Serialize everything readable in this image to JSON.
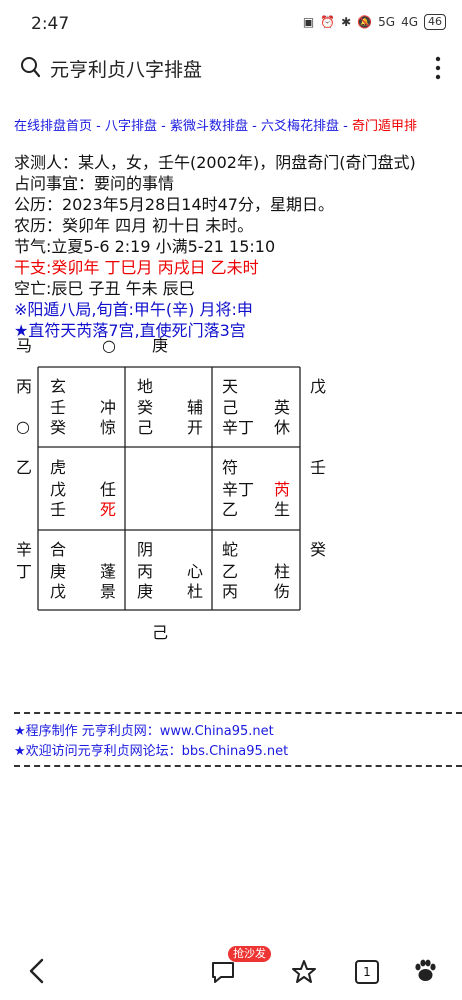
{
  "status": {
    "time": "2:47",
    "signal_a": "5G",
    "signal_b": "4G",
    "battery": "46"
  },
  "search": {
    "title": "元亨利贞八字排盘"
  },
  "nav": {
    "items": [
      "在线排盘首页",
      "八字排盘",
      "紫微斗数排盘",
      "六爻梅花排盘"
    ],
    "current": "奇门遁甲排",
    "sep": " - "
  },
  "info": {
    "line1": "求测人：某人，女，壬午(2002年)，阴盘奇门(奇门盘式)",
    "line2": "占问事宜：要问的事情",
    "line3": "公历：2023年5月28日14时47分，星期日。",
    "line4": "农历：癸卯年 四月 初十日 未时。",
    "line5": "节气:立夏5-6 2:19  小满5-21 15:10",
    "line6": "干支:癸卯年 丁巳月 丙戌日 乙未时",
    "line7": "空亡:辰巳    子丑    午未    辰巳",
    "line8": "※阳遁八局,旬首:甲午(辛) 月将:申",
    "line9": "★直符天芮落7宫,直使死门落3宫"
  },
  "chart": {
    "top": {
      "a": "马",
      "b": "○",
      "c": "庚"
    },
    "left": [
      "丙",
      "○",
      "乙",
      "辛",
      "丁"
    ],
    "right": [
      "戊",
      "壬",
      "癸"
    ],
    "bottom": "己",
    "cells": {
      "r1c1": {
        "god": "玄",
        "l2a": "壬",
        "l2b": "冲",
        "l3a": "癸",
        "l3b": "惊"
      },
      "r1c2": {
        "god": "地",
        "l2a": "癸",
        "l2b": "辅",
        "l3a": "己",
        "l3b": "开"
      },
      "r1c3": {
        "god": "天",
        "l2a": "己",
        "l2b": "英",
        "l3a": "辛丁",
        "l3b": "休"
      },
      "r2c1": {
        "god": "虎",
        "l2a": "戊",
        "l2b": "任",
        "l3a": "壬",
        "l3b": "死"
      },
      "r2c3": {
        "god": "符",
        "l2a": "辛丁",
        "l2b": "芮",
        "l3a": "乙",
        "l3b": "生"
      },
      "r3c1": {
        "god": "合",
        "l2a": "庚",
        "l2b": "蓬",
        "l3a": "戊",
        "l3b": "景"
      },
      "r3c2": {
        "god": "阴",
        "l2a": "丙",
        "l2b": "心",
        "l3a": "庚",
        "l3b": "杜"
      },
      "r3c3": {
        "god": "蛇",
        "l2a": "乙",
        "l2b": "柱",
        "l3a": "丙",
        "l3b": "伤"
      }
    }
  },
  "footer": {
    "line1": "★程序制作   元亨利贞网：www.China95.net",
    "line2": "★欢迎访问元亨利贞网论坛：bbs.China95.net"
  },
  "bottom": {
    "badge": "抢沙发",
    "page_count": "1"
  },
  "colors": {
    "link": "#1a1ae0",
    "red": "#e00000",
    "blue": "#1010cc"
  }
}
